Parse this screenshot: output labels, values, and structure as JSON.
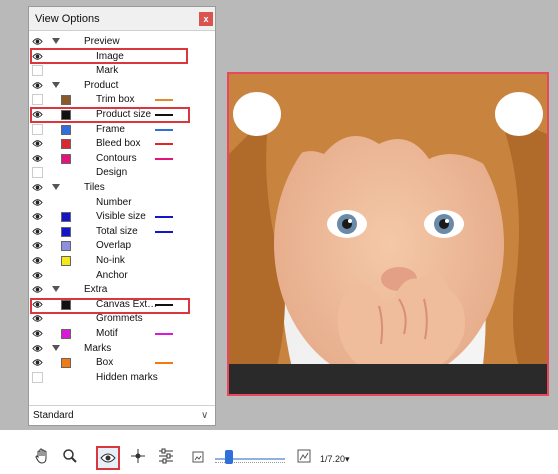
{
  "panel": {
    "title": "View Options",
    "close_label": "x",
    "select_value": "Standard",
    "select_arrow": "∨",
    "items": [
      {
        "label": "Preview",
        "eye": true,
        "caret": true,
        "indent": 55,
        "swatch": "",
        "line": ""
      },
      {
        "label": "Image",
        "eye": true,
        "caret": false,
        "indent": 67,
        "swatch": "",
        "line": ""
      },
      {
        "label": "Mark",
        "eye": false,
        "caret": false,
        "indent": 67,
        "swatch": "",
        "line": ""
      },
      {
        "label": "Product",
        "eye": true,
        "caret": true,
        "indent": 55,
        "swatch": "",
        "line": ""
      },
      {
        "label": "Trim box",
        "eye": false,
        "caret": false,
        "indent": 67,
        "swatch": "#8B5A2B",
        "line": "#e08a2a"
      },
      {
        "label": "Product size",
        "eye": true,
        "caret": false,
        "indent": 67,
        "swatch": "#111111",
        "line": "#111111"
      },
      {
        "label": "Frame",
        "eye": false,
        "caret": false,
        "indent": 67,
        "swatch": "#2f6fdc",
        "line": "#2f6fdc"
      },
      {
        "label": "Bleed box",
        "eye": true,
        "caret": false,
        "indent": 67,
        "swatch": "#e0262d",
        "line": "#e0262d"
      },
      {
        "label": "Contours",
        "eye": true,
        "caret": false,
        "indent": 67,
        "swatch": "#e0147a",
        "line": "#e0147a"
      },
      {
        "label": "Design",
        "eye": false,
        "caret": false,
        "indent": 67,
        "swatch": "",
        "line": ""
      },
      {
        "label": "Tiles",
        "eye": true,
        "caret": true,
        "indent": 55,
        "swatch": "",
        "line": ""
      },
      {
        "label": "Number",
        "eye": true,
        "caret": false,
        "indent": 67,
        "swatch": "",
        "line": ""
      },
      {
        "label": "Visible size",
        "eye": true,
        "caret": false,
        "indent": 67,
        "swatch": "#1414c8",
        "line": "#1414c8"
      },
      {
        "label": "Total size",
        "eye": true,
        "caret": false,
        "indent": 67,
        "swatch": "#1414c8",
        "line": "#1414c8"
      },
      {
        "label": "Overlap",
        "eye": true,
        "caret": false,
        "indent": 67,
        "swatch": "#8f8fe0",
        "line": ""
      },
      {
        "label": "No-ink",
        "eye": true,
        "caret": false,
        "indent": 67,
        "swatch": "#f2e81a",
        "line": ""
      },
      {
        "label": "Anchor",
        "eye": true,
        "caret": false,
        "indent": 67,
        "swatch": "",
        "line": ""
      },
      {
        "label": "Extra",
        "eye": true,
        "caret": true,
        "indent": 55,
        "swatch": "",
        "line": ""
      },
      {
        "label": "Canvas Ext…",
        "eye": true,
        "caret": false,
        "indent": 67,
        "swatch": "#111111",
        "line": "#111111"
      },
      {
        "label": "Grommets",
        "eye": true,
        "caret": false,
        "indent": 67,
        "swatch": "",
        "line": ""
      },
      {
        "label": "Motif",
        "eye": true,
        "caret": false,
        "indent": 67,
        "swatch": "#d81ad8",
        "line": "#d81ad8"
      },
      {
        "label": "Marks",
        "eye": true,
        "caret": true,
        "indent": 55,
        "swatch": "",
        "line": ""
      },
      {
        "label": "Box",
        "eye": true,
        "caret": false,
        "indent": 67,
        "swatch": "#f07b14",
        "line": "#f07b14"
      },
      {
        "label": "Hidden marks",
        "eye": false,
        "caret": false,
        "indent": 67,
        "swatch": "",
        "line": ""
      }
    ]
  },
  "toolbar": {
    "zoom_text": "1/7.20▾",
    "icons": [
      "hand-icon",
      "magnifier-icon",
      "eye-icon",
      "crosshair-icon",
      "sliders-icon",
      "small-image-icon",
      "large-image-icon"
    ]
  },
  "colors": {
    "highlight": "#d9363e",
    "preview_border": "#e8485c",
    "accent": "#2f6fdc"
  }
}
